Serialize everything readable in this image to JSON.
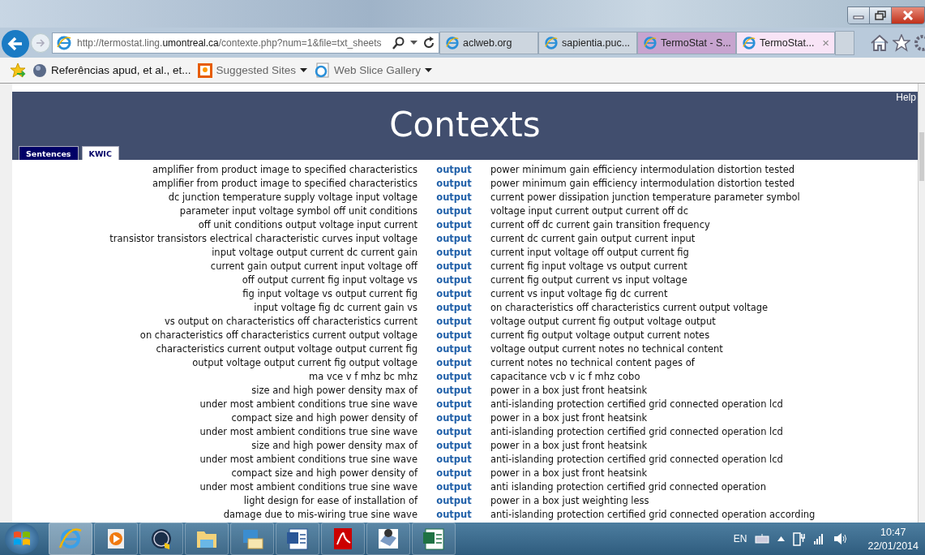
{
  "browser": {
    "address": {
      "prefix": "http://termostat.ling.",
      "domain": "umontreal.ca",
      "suffix": "/contexte.php?num=1&file=txt_sheets"
    },
    "tabs": [
      {
        "label": "aclweb.org",
        "selected": false,
        "kind": "plain"
      },
      {
        "label": "sapientia.puc...",
        "selected": false,
        "kind": "plain"
      },
      {
        "label": "TermoStat - S...",
        "selected": false,
        "kind": "group"
      },
      {
        "label": "TermoStat...",
        "selected": true,
        "kind": "group",
        "close": "×"
      }
    ],
    "favorites": [
      {
        "label": "Referências apud, et al., et...",
        "kind": "page",
        "menu": false
      },
      {
        "label": "Suggested Sites",
        "kind": "suggested",
        "menu": true
      },
      {
        "label": "Web Slice Gallery",
        "kind": "slice",
        "menu": true
      }
    ]
  },
  "page": {
    "help": "Help",
    "title": "Contexts",
    "tabs": [
      {
        "label": "Sentences",
        "selected": false
      },
      {
        "label": "KWIC",
        "selected": true
      }
    ],
    "rows": [
      {
        "left": "amplifier from product image to specified characteristics",
        "keyword": "output",
        "right": "power minimum gain efficiency intermodulation distortion tested"
      },
      {
        "left": "amplifier from product image to specified characteristics",
        "keyword": "output",
        "right": "power minimum gain efficiency intermodulation distortion tested"
      },
      {
        "left": "dc junction temperature supply voltage input voltage",
        "keyword": "output",
        "right": "current power dissipation junction temperature parameter symbol"
      },
      {
        "left": "parameter input voltage symbol off unit conditions",
        "keyword": "output",
        "right": "voltage input current output current off dc"
      },
      {
        "left": "off unit conditions output voltage input current",
        "keyword": "output",
        "right": "current off dc current gain transition frequency"
      },
      {
        "left": "transistor transistors electrical characteristic curves input voltage",
        "keyword": "output",
        "right": "current dc current gain output current input"
      },
      {
        "left": "input voltage output current dc current gain",
        "keyword": "output",
        "right": "current input voltage off output current fig"
      },
      {
        "left": "current gain output current input voltage off",
        "keyword": "output",
        "right": "current fig input voltage vs output current"
      },
      {
        "left": "off output current fig input voltage vs",
        "keyword": "output",
        "right": "current fig output current vs input voltage"
      },
      {
        "left": "fig input voltage vs output current fig",
        "keyword": "output",
        "right": "current vs input voltage fig dc current"
      },
      {
        "left": "input voltage fig dc current gain vs",
        "keyword": "output",
        "right": "on characteristics off characteristics current output voltage"
      },
      {
        "left": "vs output on characteristics off characteristics current",
        "keyword": "output",
        "right": "voltage output current fig output voltage output"
      },
      {
        "left": "on characteristics off characteristics current output voltage",
        "keyword": "output",
        "right": "current fig output voltage output current notes"
      },
      {
        "left": "characteristics current output voltage output current fig",
        "keyword": "output",
        "right": "voltage output current notes no technical content"
      },
      {
        "left": "output voltage output current fig output voltage",
        "keyword": "output",
        "right": "current notes no technical content pages of"
      },
      {
        "left": "ma vce v f mhz bc mhz",
        "keyword": "output",
        "right": "capacitance vcb v ic f mhz cobo"
      },
      {
        "left": "size and high power density max of",
        "keyword": "output",
        "right": "power in a box just front heatsink"
      },
      {
        "left": "under most ambient conditions true sine wave",
        "keyword": "output",
        "right": "anti-islanding protection certified grid connected operation lcd"
      },
      {
        "left": "compact size and high power density of",
        "keyword": "output",
        "right": "power in a box just front heatsink"
      },
      {
        "left": "under most ambient conditions true sine wave",
        "keyword": "output",
        "right": "anti-islanding protection certified grid connected operation lcd"
      },
      {
        "left": "size and high power density max of",
        "keyword": "output",
        "right": "power in a box just front heatsink"
      },
      {
        "left": "under most ambient conditions true sine wave",
        "keyword": "output",
        "right": "anti-islanding protection certified grid connected operation lcd"
      },
      {
        "left": "compact size and high power density of",
        "keyword": "output",
        "right": "power in a box just front heatsink"
      },
      {
        "left": "under most ambient conditions true sine wave",
        "keyword": "output",
        "right": "anti islanding protection certified grid connected operation"
      },
      {
        "left": "light design for ease of installation of",
        "keyword": "output",
        "right": "power in a box just weighting less"
      },
      {
        "left": "damage due to mis-wiring true sine wave",
        "keyword": "output",
        "right": "anti-islanding protection certified grid connected operation according"
      }
    ]
  },
  "taskbar": {
    "apps": [
      {
        "kind": "ie",
        "active": true
      },
      {
        "kind": "media",
        "active": false
      },
      {
        "kind": "hp",
        "active": false
      },
      {
        "kind": "folder",
        "active": false
      },
      {
        "kind": "mail",
        "active": false
      },
      {
        "kind": "word",
        "active": false
      },
      {
        "kind": "pdf",
        "active": false
      },
      {
        "kind": "tool",
        "active": false
      },
      {
        "kind": "excel",
        "active": false
      }
    ],
    "language": "EN",
    "time": "10:47",
    "date": "22/01/2014"
  }
}
